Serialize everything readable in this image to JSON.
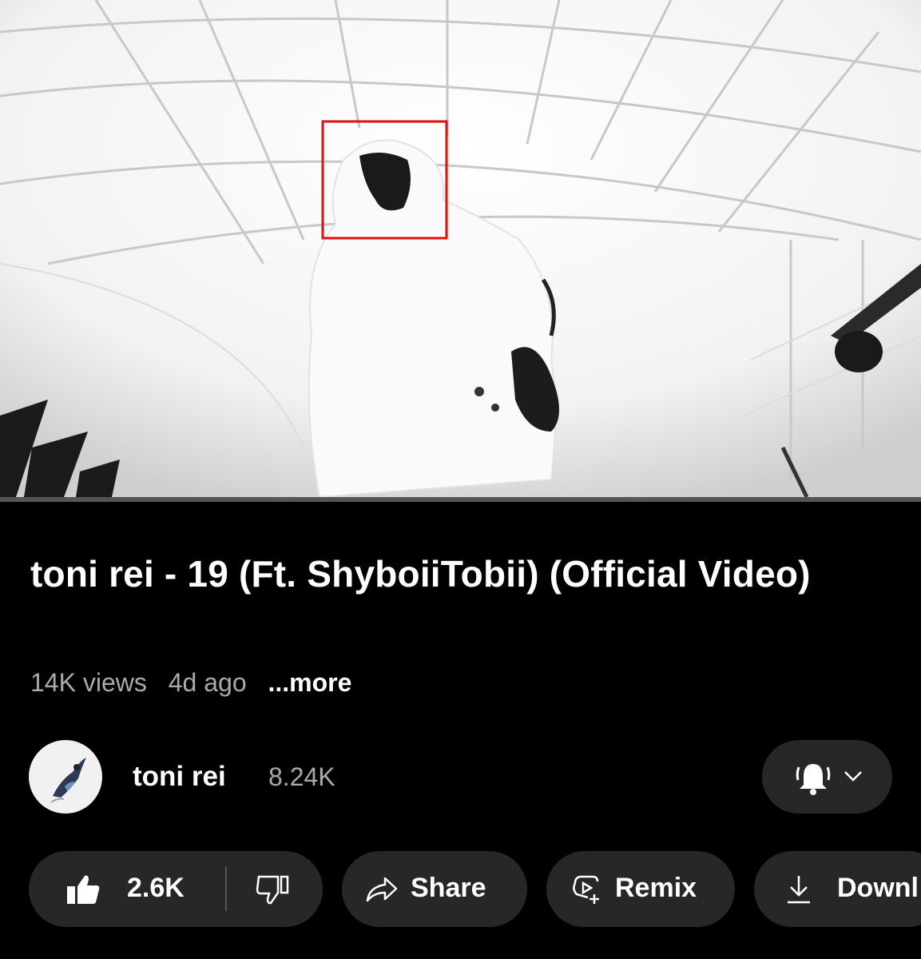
{
  "video": {
    "title": "toni rei - 19 (Ft. ShyboiiTobii) (Official Video)",
    "views": "14K views",
    "age": "4d ago",
    "more_label": "...more"
  },
  "channel": {
    "name": "toni rei",
    "subscribers": "8.24K",
    "avatar_icon": "channel-avatar",
    "bell_icon": "notification-bell-icon",
    "chevron_icon": "chevron-down-icon"
  },
  "actions": {
    "like_count": "2.6K",
    "like_icon": "thumbs-up-icon",
    "dislike_icon": "thumbs-down-icon",
    "share_label": "Share",
    "share_icon": "share-arrow-icon",
    "remix_label": "Remix",
    "remix_icon": "remix-icon",
    "download_label": "Downl",
    "download_icon": "download-icon"
  },
  "colors": {
    "background": "#000000",
    "pill": "#272727",
    "secondary_text": "#aaaaaa",
    "highlight_box": "#e01010"
  }
}
